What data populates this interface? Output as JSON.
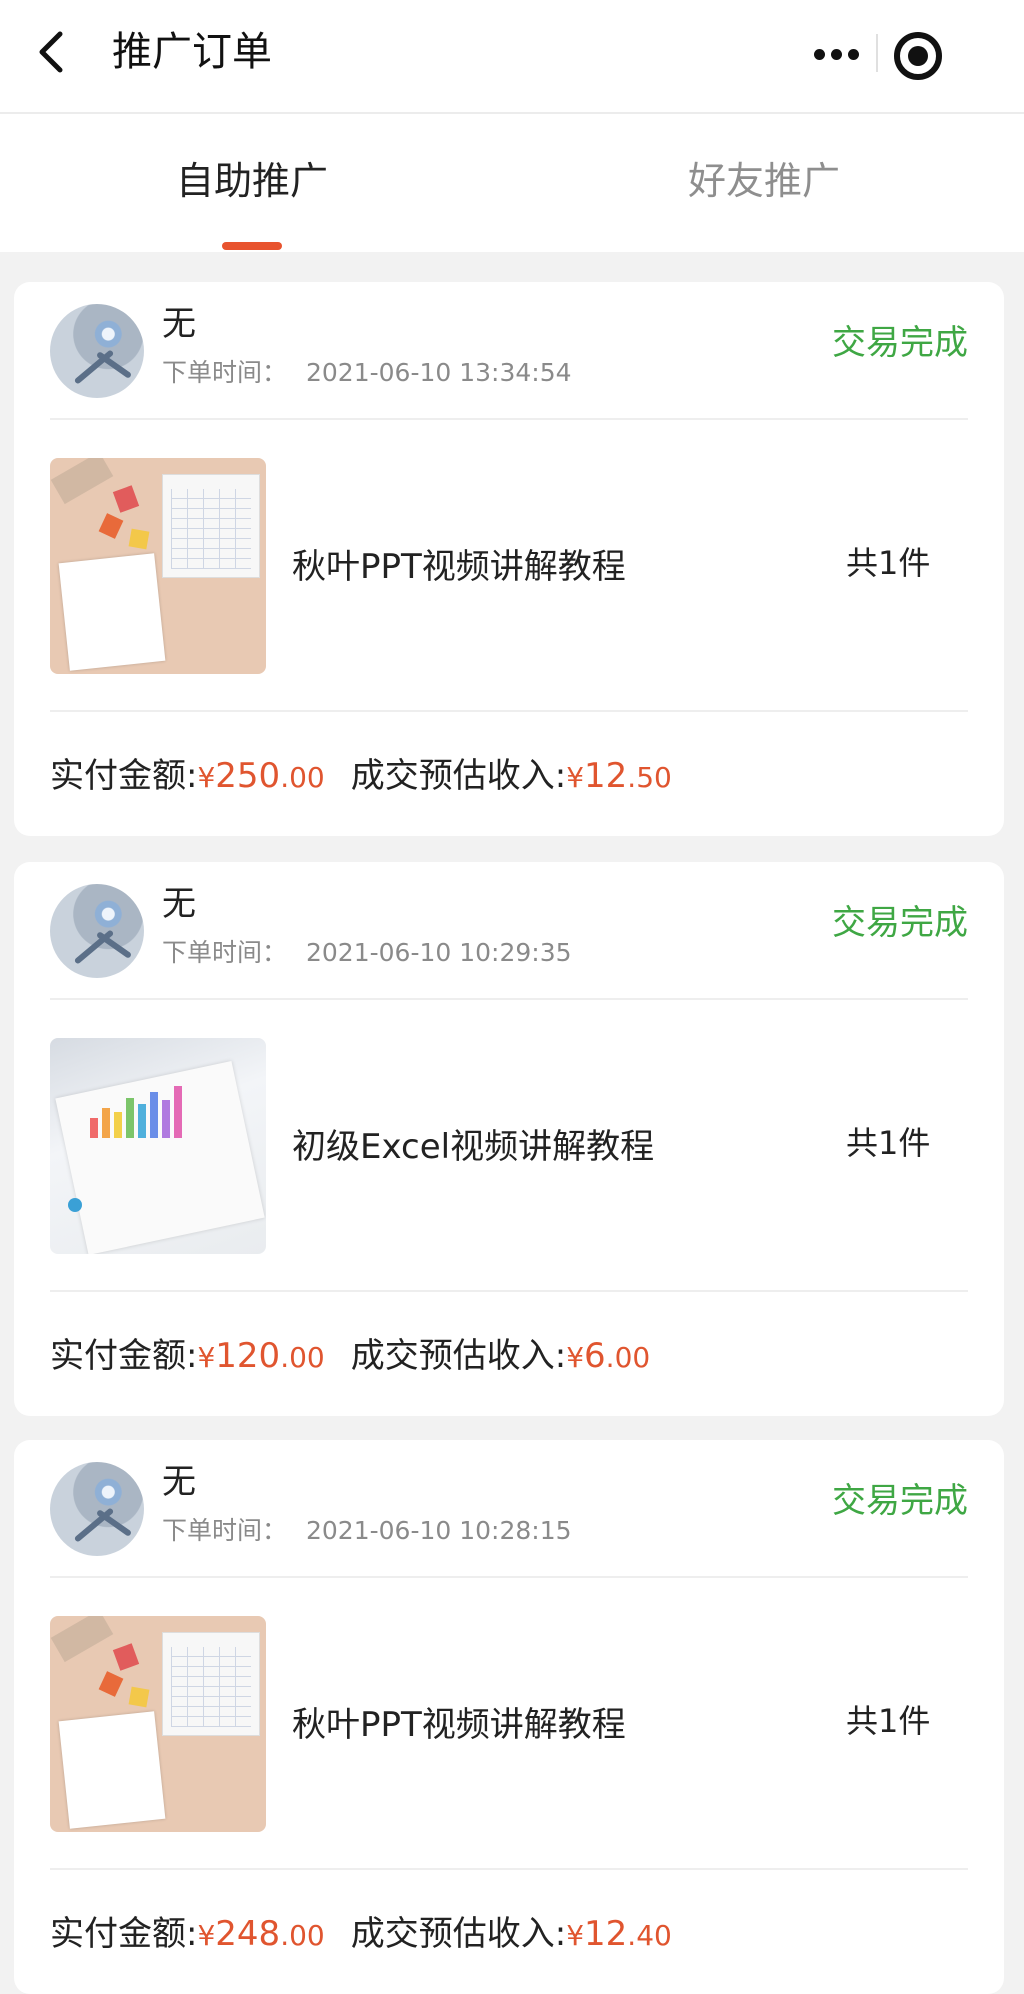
{
  "nav": {
    "title": "推广订单"
  },
  "tabs": [
    {
      "label": "自助推广",
      "active": true
    },
    {
      "label": "好友推广",
      "active": false
    }
  ],
  "orders": [
    {
      "buyer": "无",
      "time_label": "下单时间：",
      "time": "2021-06-10 13:34:54",
      "status": "交易完成",
      "product": "秋叶PPT视频讲解教程",
      "quantity": "共1件",
      "paid_label": "实付金额:",
      "paid_currency": "¥",
      "paid_int": "250",
      "paid_dec": ".00",
      "income_label": "成交预估收入:",
      "income_currency": "¥",
      "income_int": "12",
      "income_dec": ".50"
    },
    {
      "buyer": "无",
      "time_label": "下单时间：",
      "time": "2021-06-10 10:29:35",
      "status": "交易完成",
      "product": "初级Excel视频讲解教程",
      "quantity": "共1件",
      "paid_label": "实付金额:",
      "paid_currency": "¥",
      "paid_int": "120",
      "paid_dec": ".00",
      "income_label": "成交预估收入:",
      "income_currency": "¥",
      "income_int": "6",
      "income_dec": ".00"
    },
    {
      "buyer": "无",
      "time_label": "下单时间：",
      "time": "2021-06-10 10:28:15",
      "status": "交易完成",
      "product": "秋叶PPT视频讲解教程",
      "quantity": "共1件",
      "paid_label": "实付金额:",
      "paid_currency": "¥",
      "paid_int": "248",
      "paid_dec": ".00",
      "income_label": "成交预估收入:",
      "income_currency": "¥",
      "income_int": "12",
      "income_dec": ".40"
    }
  ],
  "colors": {
    "accent": "#e8532e",
    "status_green": "#3fa744",
    "price_red": "#e0552f"
  },
  "icons": [
    "back-arrow-icon",
    "more-dots-icon",
    "close-target-icon"
  ]
}
